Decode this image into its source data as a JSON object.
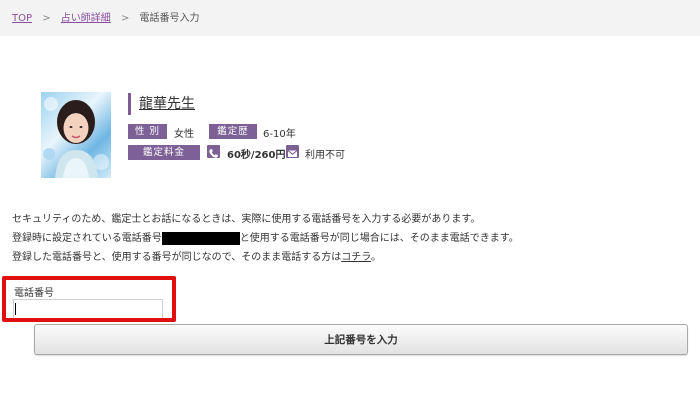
{
  "breadcrumb": {
    "items": [
      {
        "label": "TOP"
      },
      {
        "label": "占い師詳細"
      },
      {
        "label": "電話番号入力"
      }
    ],
    "separator": ">"
  },
  "fortune_teller": {
    "name": "龍華先生",
    "gender_tag": "性 別",
    "gender_value": "女性",
    "career_tag": "鑑定歴",
    "career_value": "6-10年",
    "fee_tag": "鑑定料金",
    "phone_icon": "phone-icon",
    "fee_value": "60秒/260円",
    "mail_icon": "mail-icon",
    "mail_value": "利用不可"
  },
  "notice": {
    "line1": "セキュリティのため、鑑定士とお話になるときは、実際に使用する電話番号を入力する必要があります。",
    "line2_before": "登録時に設定されている電話番号",
    "line2_after": "と使用する電話番号が同じ場合には、そのまま電話できます。",
    "line3_before": "登録した電話番号と、使用する番号が同じなので、そのまま電話する方は",
    "line3_link": "コチラ",
    "line3_after": "。"
  },
  "form": {
    "phone_label": "電話番号",
    "phone_value": "",
    "submit_label": "上記番号を入力"
  },
  "colors": {
    "accent": "#7d6196",
    "link": "#8a4fa0",
    "highlight": "#e01010"
  }
}
